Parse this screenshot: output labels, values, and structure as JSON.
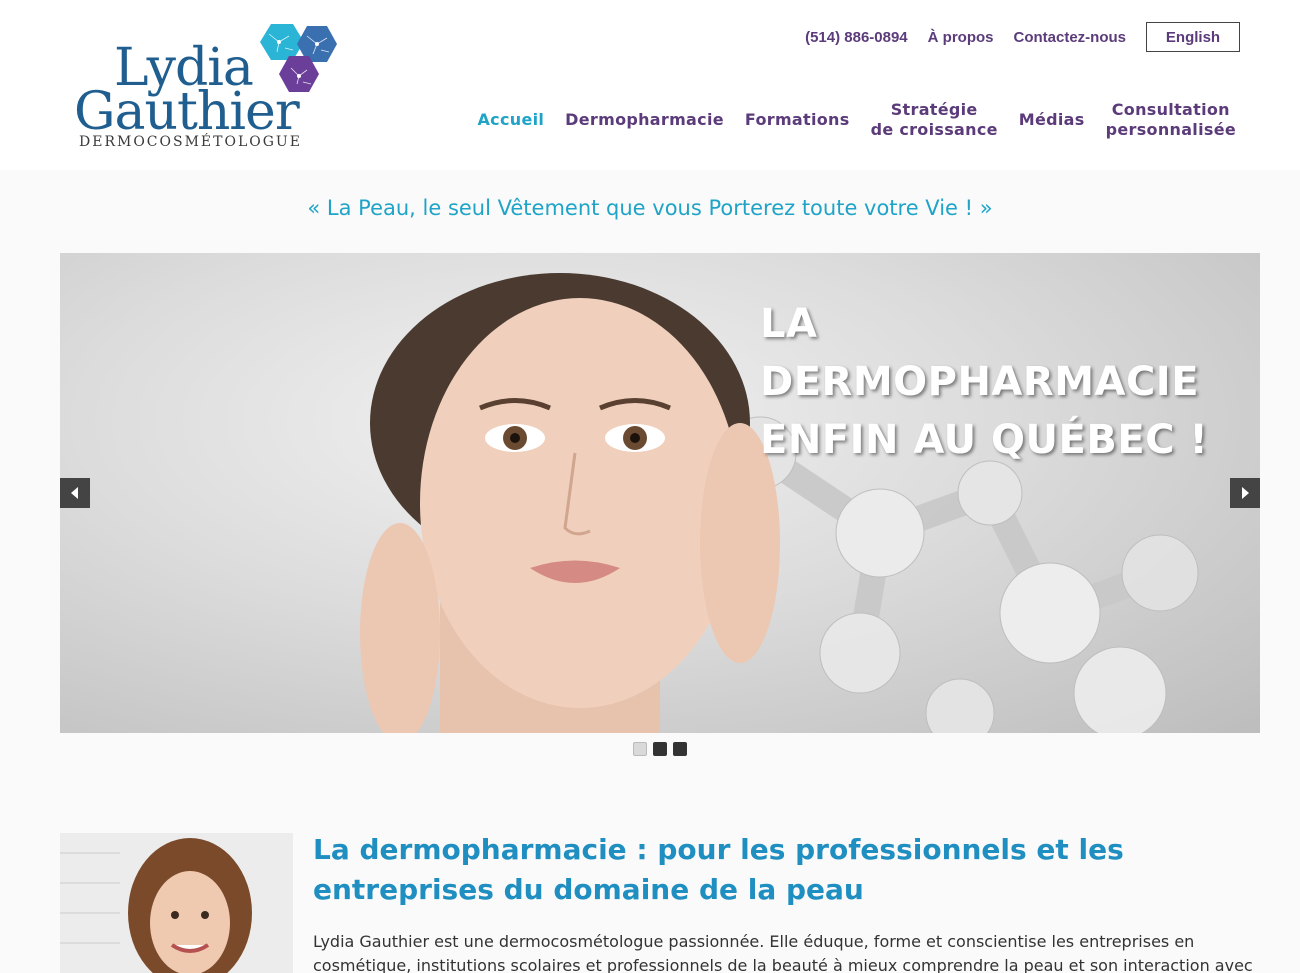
{
  "logo": {
    "first_name": "Lydia",
    "last_name": "Gauthier",
    "subtitle": "DERMOCOSMÉTOLOGUE"
  },
  "topbar": {
    "phone": "(514) 886-0894",
    "about": "À propos",
    "contact": "Contactez-nous",
    "language": "English"
  },
  "nav": {
    "items": [
      {
        "label": "Accueil",
        "active": true
      },
      {
        "label": "Dermopharmacie"
      },
      {
        "label": "Formations"
      },
      {
        "label": "Stratégie\nde croissance"
      },
      {
        "label": "Médias"
      },
      {
        "label": "Consultation\npersonnalisée"
      }
    ]
  },
  "tagline": "« La Peau, le seul Vêtement que vous Porterez toute votre Vie ! »",
  "slider": {
    "headline_line1": "LA DERMOPHARMACIE",
    "headline_line2": "ENFIN AU QUÉBEC !",
    "slide_count": 3,
    "active_slide": 1
  },
  "intro": {
    "title": "La dermopharmacie : pour les professionnels et les entreprises du domaine de la peau",
    "body": "Lydia Gauthier est une dermocosmétologue passionnée. Elle éduque, forme et conscientise les entreprises en cosmétique, institutions scolaires et professionnels de la beauté à mieux comprendre la peau et son interaction avec"
  },
  "colors": {
    "brand_blue": "#1f5e8f",
    "accent_cyan": "#1fa4c8",
    "nav_purple": "#5b3b7a",
    "title_blue": "#1f8ec0"
  }
}
